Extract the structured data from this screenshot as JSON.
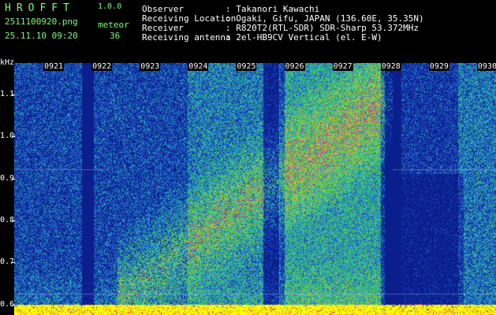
{
  "header": {
    "app_title": "HROFFT",
    "app_version": "1.0.0",
    "file_name": "2511100920.png",
    "date_time": "25.11.10 09:20",
    "meteor_label": "meteor",
    "meteor_count": "36"
  },
  "info": [
    {
      "label": "Observer",
      "value": ": Takanori Kawachi"
    },
    {
      "label": "Receiving Location",
      "value": ": Ogaki, Gifu, JAPAN (136.60E, 35.35N)"
    },
    {
      "label": "Receiver",
      "value": ": R820T2(RTL-SDR) SDR-Sharp 53.372MHz"
    },
    {
      "label": "Receiving antenna",
      "value": ": 2el-HB9CV Vertical (el. E-W)"
    }
  ],
  "chart_data": {
    "type": "heatmap",
    "ylabel": "kHz",
    "x_tick_labels": [
      "0921",
      "0922",
      "0923",
      "0924",
      "0925",
      "0926",
      "0927",
      "0928",
      "0929",
      "0930"
    ],
    "y_tick_labels": [
      "1.1",
      "1.0",
      "0.9",
      "0.8",
      "0.7",
      "0.6"
    ],
    "y_ticks": [
      1.1,
      1.0,
      0.9,
      0.8,
      0.7,
      0.6
    ],
    "ylim": [
      0.575,
      1.175
    ],
    "xlim": [
      "0921",
      "0931"
    ],
    "colormap": [
      "#0a1e8c",
      "#1e50c8",
      "#28b4b4",
      "#50c850",
      "#c8c832",
      "#e63c78",
      "#ffff00"
    ]
  }
}
